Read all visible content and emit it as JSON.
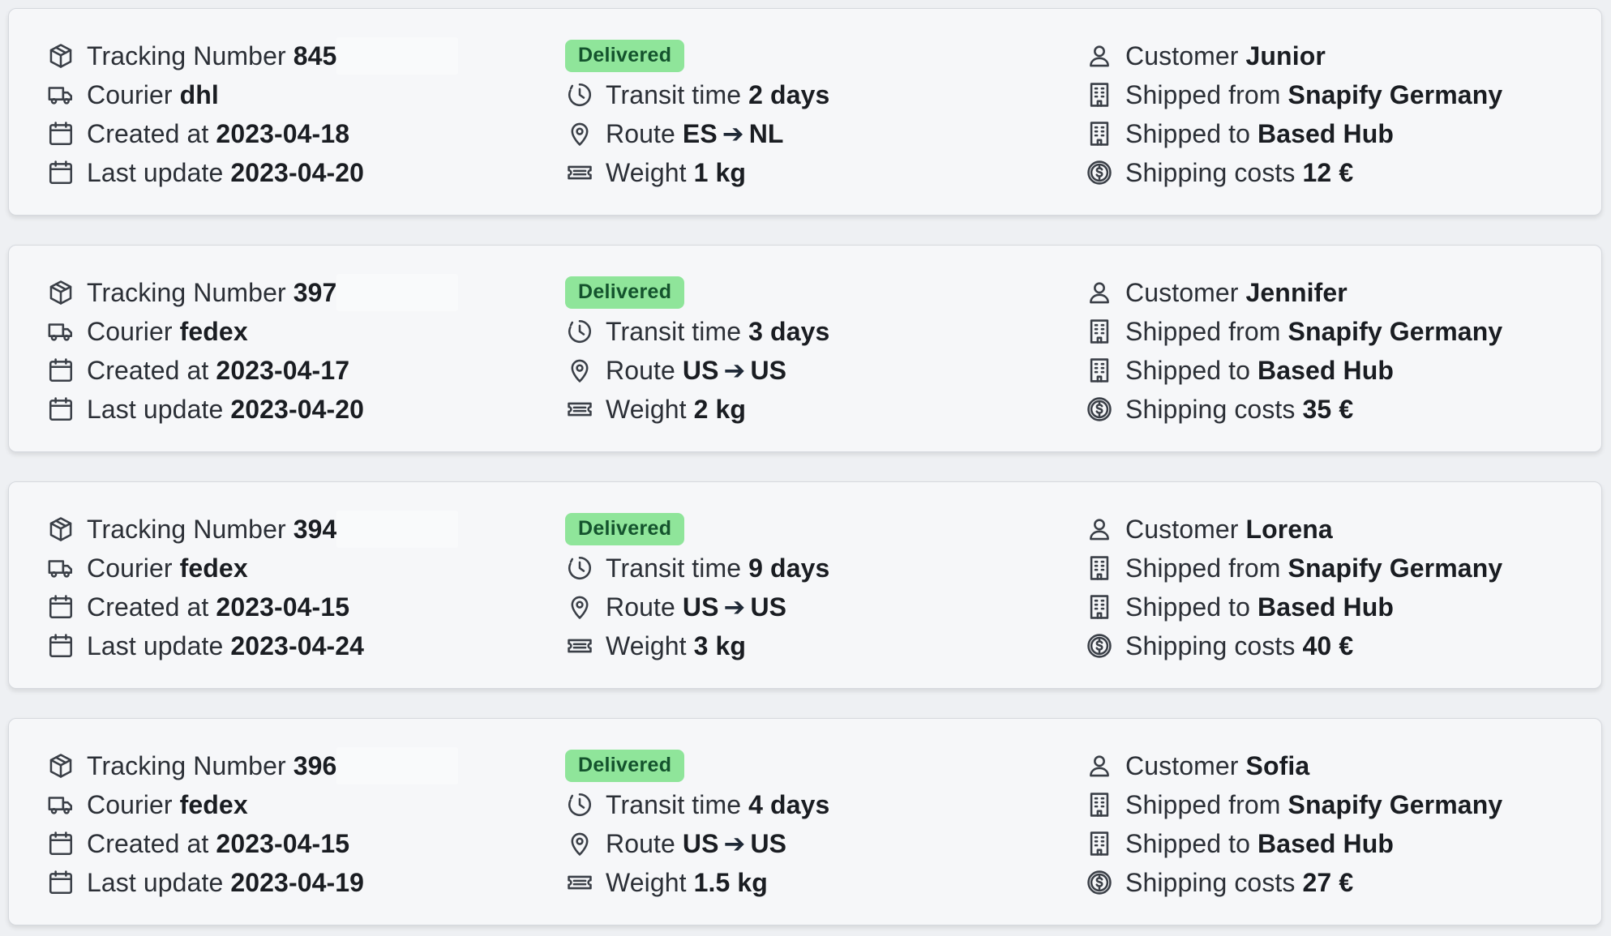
{
  "labels": {
    "tracking_number": "Tracking Number",
    "courier": "Courier",
    "created_at": "Created at",
    "last_update": "Last update",
    "transit_time": "Transit time",
    "route": "Route",
    "route_arrow": "➔",
    "weight": "Weight",
    "customer": "Customer",
    "shipped_from": "Shipped from",
    "shipped_to": "Shipped to",
    "shipping_costs": "Shipping costs"
  },
  "icons": {
    "tracking_number": "package-icon",
    "courier": "truck-icon",
    "created_at": "calendar-icon",
    "last_update": "calendar-icon",
    "transit_time": "clock-icon",
    "route": "map-pin-icon",
    "weight": "ticket-icon",
    "customer": "user-icon",
    "shipped_from": "building-icon",
    "shipped_to": "building-icon",
    "shipping_costs": "dollar-coin-icon"
  },
  "colors": {
    "status_badge_bg": "#8fe59a",
    "status_badge_text": "#14532d",
    "card_bg": "#f6f7f9"
  },
  "shipments": [
    {
      "tracking_number": "845",
      "courier": "dhl",
      "created_at": "2023-04-18",
      "last_update": "2023-04-20",
      "status": "Delivered",
      "transit_time": "2 days",
      "route_from": "ES",
      "route_to": "NL",
      "weight": "1 kg",
      "customer": "Junior",
      "shipped_from": "Snapify Germany",
      "shipped_to": "Based Hub",
      "shipping_costs": "12 €"
    },
    {
      "tracking_number": "397",
      "courier": "fedex",
      "created_at": "2023-04-17",
      "last_update": "2023-04-20",
      "status": "Delivered",
      "transit_time": "3 days",
      "route_from": "US",
      "route_to": "US",
      "weight": "2 kg",
      "customer": "Jennifer",
      "shipped_from": "Snapify Germany",
      "shipped_to": "Based Hub",
      "shipping_costs": "35 €"
    },
    {
      "tracking_number": "394",
      "courier": "fedex",
      "created_at": "2023-04-15",
      "last_update": "2023-04-24",
      "status": "Delivered",
      "transit_time": "9 days",
      "route_from": "US",
      "route_to": "US",
      "weight": "3 kg",
      "customer": "Lorena",
      "shipped_from": "Snapify Germany",
      "shipped_to": "Based Hub",
      "shipping_costs": "40 €"
    },
    {
      "tracking_number": "396",
      "courier": "fedex",
      "created_at": "2023-04-15",
      "last_update": "2023-04-19",
      "status": "Delivered",
      "transit_time": "4 days",
      "route_from": "US",
      "route_to": "US",
      "weight": "1.5 kg",
      "customer": "Sofia",
      "shipped_from": "Snapify Germany",
      "shipped_to": "Based Hub",
      "shipping_costs": "27 €"
    }
  ]
}
